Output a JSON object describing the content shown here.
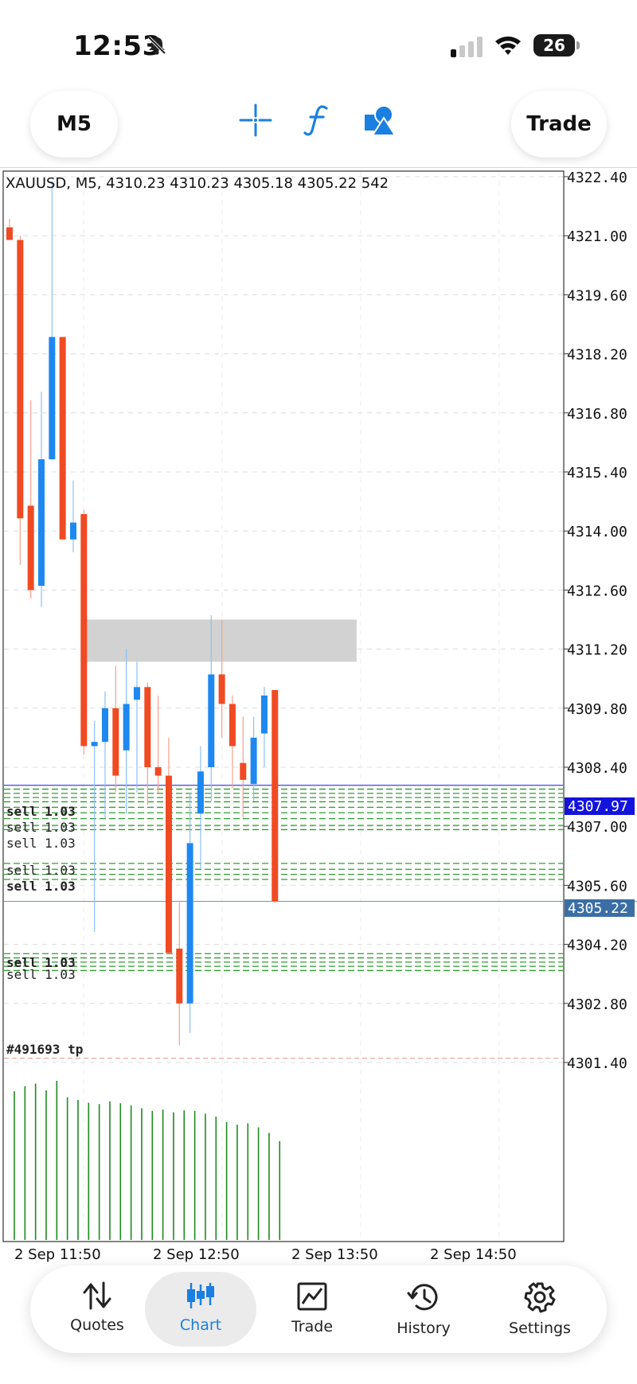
{
  "status_bar": {
    "time": "12:53",
    "battery": "26"
  },
  "toolbar": {
    "timeframe": "M5",
    "trade_label": "Trade"
  },
  "chart": {
    "info_line": "XAUUSD, M5, 4310.23 4310.23 4305.18 4305.22 542",
    "price_labels": [
      "4322.40",
      "4321.00",
      "4319.60",
      "4318.20",
      "4316.80",
      "4315.40",
      "4314.00",
      "4312.60",
      "4311.20",
      "4309.80",
      "4308.40",
      "4307.00",
      "4305.60",
      "4304.20",
      "4302.80",
      "4301.40"
    ],
    "current_bid": "4305.22",
    "ask_level": "4307.97",
    "time_labels": [
      "2 Sep 11:50",
      "2 Sep 12:50",
      "2 Sep 13:50",
      "2 Sep 14:50"
    ],
    "order_labels": {
      "group1": "sell 1.03",
      "group2": "sell 1.03",
      "group3": "sell 1.03",
      "tp_label": "#491693 tp"
    },
    "colors": {
      "bull": "#1e88f0",
      "bear": "#f04a23",
      "grid": "#dcdcdc",
      "order_line": "#2e9e2e",
      "ask_bg": "#1313dd",
      "bid_bg": "#3a6ea5",
      "volume": "#1f8a1f"
    }
  },
  "chart_data": {
    "type": "candlestick",
    "symbol": "XAUUSD",
    "timeframe": "M5",
    "ylim": [
      4300.4,
      4323.4
    ],
    "candles": [
      {
        "o": 4321.2,
        "h": 4321.4,
        "l": 4320.9,
        "c": 4320.9
      },
      {
        "o": 4320.9,
        "h": 4321.0,
        "l": 4313.2,
        "c": 4314.3
      },
      {
        "o": 4314.6,
        "h": 4317.1,
        "l": 4312.4,
        "c": 4312.6
      },
      {
        "o": 4312.7,
        "h": 4317.3,
        "l": 4312.2,
        "c": 4315.7
      },
      {
        "o": 4315.7,
        "h": 4322.3,
        "l": 4315.7,
        "c": 4318.6
      },
      {
        "o": 4318.6,
        "h": 4318.6,
        "l": 4313.8,
        "c": 4313.8
      },
      {
        "o": 4313.8,
        "h": 4315.2,
        "l": 4313.5,
        "c": 4314.2
      },
      {
        "o": 4314.4,
        "h": 4314.5,
        "l": 4308.7,
        "c": 4308.9
      },
      {
        "o": 4308.9,
        "h": 4309.5,
        "l": 4304.5,
        "c": 4309.0
      },
      {
        "o": 4309.0,
        "h": 4310.2,
        "l": 4307.2,
        "c": 4309.8
      },
      {
        "o": 4309.8,
        "h": 4310.8,
        "l": 4307.8,
        "c": 4308.2
      },
      {
        "o": 4308.8,
        "h": 4311.2,
        "l": 4307.3,
        "c": 4309.9
      },
      {
        "o": 4310.0,
        "h": 4310.9,
        "l": 4307.8,
        "c": 4310.3
      },
      {
        "o": 4310.3,
        "h": 4310.4,
        "l": 4307.5,
        "c": 4308.4
      },
      {
        "o": 4308.4,
        "h": 4310.1,
        "l": 4307.8,
        "c": 4308.2
      },
      {
        "o": 4308.2,
        "h": 4309.1,
        "l": 4304.0,
        "c": 4304.0
      },
      {
        "o": 4304.1,
        "h": 4305.2,
        "l": 4301.8,
        "c": 4302.8
      },
      {
        "o": 4302.8,
        "h": 4307.8,
        "l": 4302.1,
        "c": 4306.6
      },
      {
        "o": 4307.3,
        "h": 4308.9,
        "l": 4306.0,
        "c": 4308.3
      },
      {
        "o": 4308.4,
        "h": 4312.0,
        "l": 4307.6,
        "c": 4310.6
      },
      {
        "o": 4310.6,
        "h": 4311.9,
        "l": 4309.1,
        "c": 4309.9
      },
      {
        "o": 4309.9,
        "h": 4310.1,
        "l": 4307.9,
        "c": 4308.9
      },
      {
        "o": 4308.5,
        "h": 4309.6,
        "l": 4307.2,
        "c": 4308.1
      },
      {
        "o": 4308.0,
        "h": 4309.6,
        "l": 4307.6,
        "c": 4309.1
      },
      {
        "o": 4309.2,
        "h": 4310.3,
        "l": 4308.4,
        "c": 4310.1
      },
      {
        "o": 4310.23,
        "h": 4310.23,
        "l": 4305.18,
        "c": 4305.22
      }
    ],
    "volume": [
      542,
      560,
      570,
      545,
      580,
      520,
      510,
      500,
      495,
      505,
      498,
      490,
      480,
      470,
      475,
      465,
      472,
      470,
      460,
      450,
      430,
      420,
      425,
      410,
      390,
      360
    ],
    "supply_zone": {
      "top": 4311.9,
      "bottom": 4310.9,
      "start_index": 7,
      "end_index": 33
    },
    "order_levels": [
      4307.88,
      4307.78,
      4307.68,
      4307.58,
      4307.45,
      4307.32,
      4307.18,
      4307.02,
      4306.92,
      4306.12,
      4305.98,
      4305.86,
      4305.74,
      4303.98,
      4303.88,
      4303.78,
      4303.68,
      4303.58
    ],
    "tp_level": 4301.5,
    "ask": 4307.97,
    "bid": 4305.22
  },
  "bottom_nav": {
    "items": [
      {
        "label": "Quotes",
        "icon": "quotes-arrows-icon"
      },
      {
        "label": "Chart",
        "icon": "chart-candles-icon"
      },
      {
        "label": "Trade",
        "icon": "trade-line-icon"
      },
      {
        "label": "History",
        "icon": "history-clock-icon"
      },
      {
        "label": "Settings",
        "icon": "gear-icon"
      }
    ]
  }
}
